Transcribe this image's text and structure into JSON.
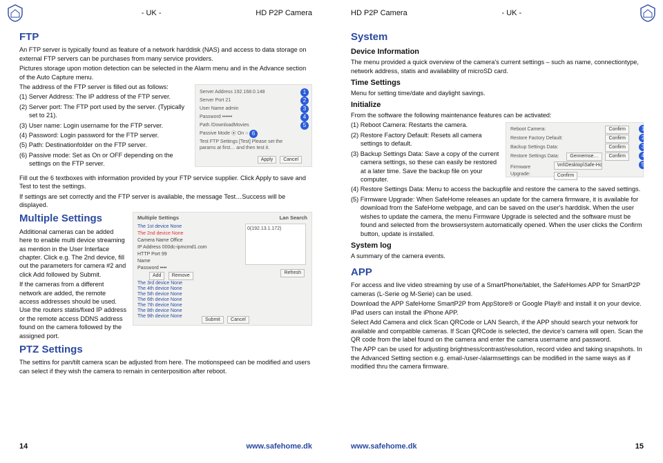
{
  "header": {
    "uk": "- UK -",
    "title": "HD P2P Camera"
  },
  "left": {
    "ftp": {
      "heading": "FTP",
      "p1": "An FTP server is typically found as feature of a network harddisk (NAS) and access to data storage on external FTP servers can be purchases from many service providers.",
      "p2": "Pictures storage upon motion detection can be selected in the Alarm menu and in the Advance section of the Auto Capture menu.",
      "p3": "The address of the FTP server is filled out as follows:",
      "i1": "(1) Server Address: The IP address of the FTP server.",
      "i2": "(2) Server port: The FTP port used by the server. (Typically set to 21).",
      "i3": "(3) User name: Login username for the FTP server.",
      "i4": "(4) Password: Login password for the FTP server.",
      "i5": "(5) Path: Destinationfolder on the FTP server.",
      "i6": "(6) Passive mode: Set as On or OFF depending on the settings on the FTP server.",
      "p4": "Fill out the 6 textboxes with information provided by your FTP service supplier. Click Apply to save and Test to test the settings.",
      "p5": "If settings are set correctly and the FTP server is available, the message Test…Success will be displayed.",
      "fig": {
        "serverAddress": "Server Address  192.168.0.148",
        "serverPort": "Server Port  21",
        "userName": "User Name  admin",
        "password": "Password  ••••••",
        "path": "Path  /DownloadMovies",
        "passive": "Passive Mode   ⦿ On  ○ Off",
        "test": "Test FTP Settings   [Test]  Please set the params at first… and then test it.",
        "apply": "Apply",
        "cancel": "Cancel"
      }
    },
    "ms": {
      "heading": "Multiple Settings",
      "p1": "Additional cameras can be added here to enable multi device streaming as mention in the User Interface chapter. Click e.g. The 2nd device, fill out the parameters for camera #2 and click Add followed by Submit.",
      "p2": "If the cameras from a different network are added, the remote access addresses should be used. Use the routers statis/fixed IP address or the remote access DDNS address found on the camera followed by the assigned port.",
      "fig": {
        "tabs": "Multiple Settings                              Lan Search",
        "row1": "The 1st device   None",
        "row2": "The 2nd device   None",
        "cname": "Camera Name  Office",
        "ip": "IP Address  000dc-ipmcmd1.com",
        "http": "HTTP Port  99",
        "user": "Name",
        "pwd": "Password  ••••",
        "addrem": "Add   Remove",
        "search": "0(192.13.1.172)",
        "refresh": "Refresh",
        "r3": "The 3rd device   None",
        "r4": "The 4th device   None",
        "r5": "The 5th device   None",
        "r6": "The 6th device   None",
        "r7": "The 7th device   None",
        "r8": "The 8th device   None",
        "r9": "The 9th device   None",
        "submit": "Submit",
        "cancel": "Cancel"
      }
    },
    "ptz": {
      "heading": "PTZ Settings",
      "p1": "The settins for pan/tilt camera scan be adjusted from here. The motionspeed can be modified and users can select if they wish the camera to remain in centerposition after reboot."
    },
    "footer": {
      "pagenum": "14",
      "url": "www.safehome.dk"
    }
  },
  "right": {
    "system": {
      "heading": "System",
      "dev": {
        "heading": "Device Information",
        "p1": "The menu provided a quick overview of the camera's current settings – such as name, connectiontype, network address, statis and availability of microSD card."
      },
      "time": {
        "heading": "Time Settings",
        "p1": "Menu for setting time/date and daylight savings."
      },
      "init": {
        "heading": "Initialize",
        "p0": " From the software the following maintenance features can be activated:",
        "i1": "(1) Reboot Camera: Restarts the camera.",
        "i2": "(2) Restore Factory Default: Resets all camera settings to default.",
        "i3": "(3) Backup Settings Data: Save a copy of the current camera settings, so these can easily be restored at a later time. Save the backup file on your computer.",
        "i4": "(4) Restore Settings Data: Menu to access the backupfile and restore the camera to the saved settings.",
        "i5": "(5) Firmware Upgrade: When SafeHome releases an update for the camera firmware, it is available for download from the SafeHome webpage, and can be saved on the user's harddisk. When the user wishes to update the camera, the menu Firmware Upgrade is selected and the software must be found and selected from the browsersystem automatically opened. When the user clicks the Confirm button, update is installed.",
        "fig": {
          "r1l": "Reboot Camera:",
          "r1b": "Confirm",
          "r2l": "Restore Factory Default:",
          "r2b": "Confirm",
          "r3l": "Backup Settings Data:",
          "r3b": "Confirm",
          "r4l": "Restore Settings Data:",
          "r4m": "Gennemse…",
          "r4b": "Confirm",
          "r5l": "Firmware Upgrade:",
          "r5m": "\\mt\\Desktop\\Safe-Home M…  Gennemse…",
          "r5b": "Confirm"
        }
      },
      "log": {
        "heading": "System log",
        "p1": "A summary of the camera events."
      }
    },
    "app": {
      "heading": "APP",
      "p1": "For access and live video streaming by use of a SmartPhone/tablet, the SafeHomes APP for SmartP2P cameras (L-Serie og M-Serie) can be used.",
      "p2": "Download the APP SafeHome SmartP2P from AppStore® or Google Play® and install it on your device. IPad users can install the iPhone APP.",
      "p3": "Select Add Camera and click Scan QRCode or LAN Search, if the APP should search your network for available and compatible cameras. If Scan QRCode is selected, the device's camera will open. Scan the QR code from the label found on the camera and enter the camera username and password.",
      "p4": "The APP can be used for adjusting brightness/contrast/resolution, record video and taking snapshots. In the Advanced Setting section e.g. email-/user-/alarmsettings can be modified in the same ways as if modified thru the camera firmware."
    },
    "footer": {
      "pagenum": "15",
      "url": "www.safehome.dk"
    }
  },
  "logo": {
    "alt": "SafeHome shield"
  }
}
